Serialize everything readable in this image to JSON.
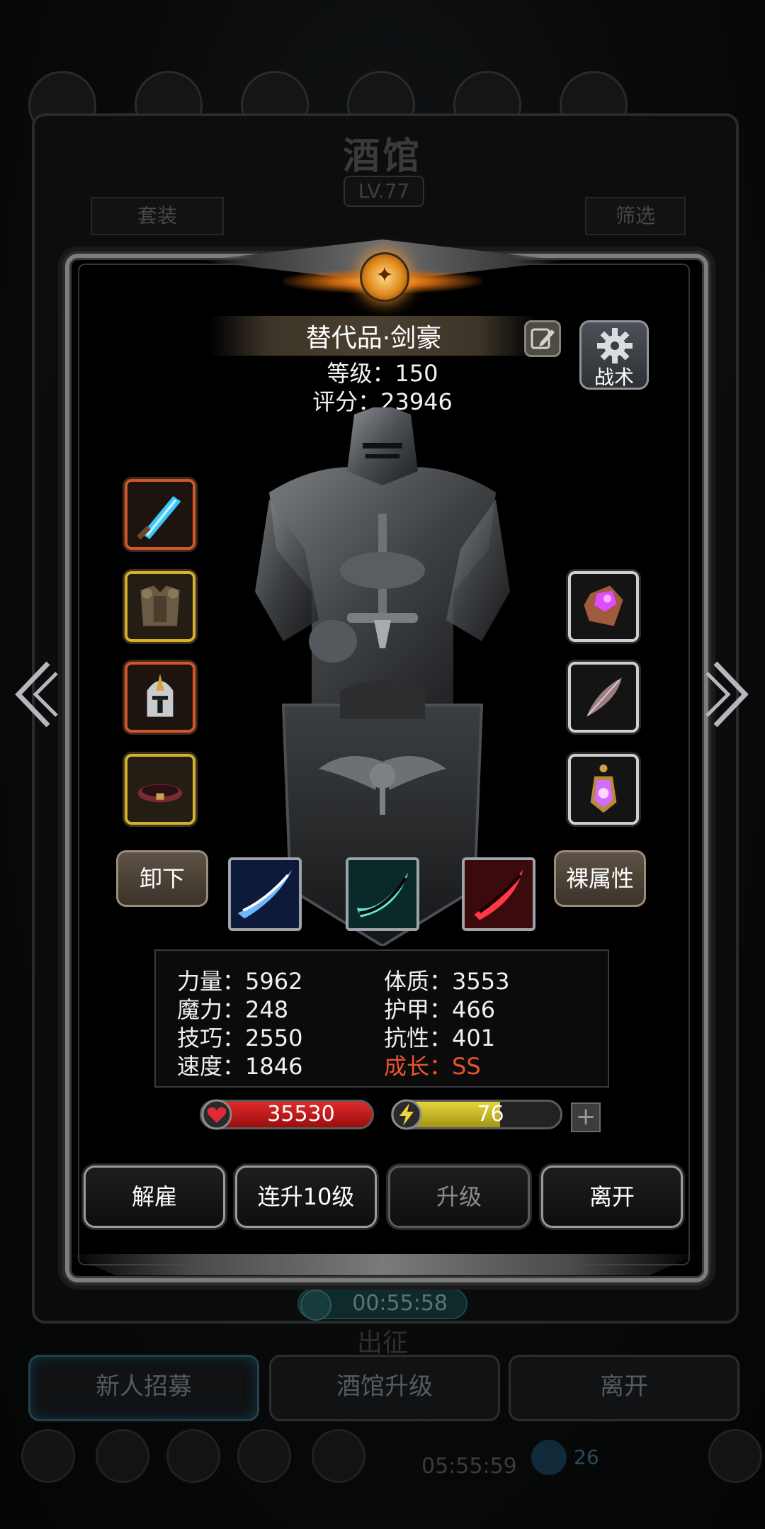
{
  "background": {
    "title": "酒馆",
    "level": "LV.77",
    "tab_left": "套装",
    "tab_right": "筛选",
    "timer": "00:55:58",
    "march_label": "出征",
    "buttons": [
      "新人招募",
      "酒馆升级",
      "离开"
    ],
    "bottom_time": "05:55:59",
    "bottom_count": "26"
  },
  "hero": {
    "name": "替代品·剑豪",
    "level_text": "等级：150",
    "score_text": "评分：23946",
    "tactics_label": "战术"
  },
  "equipment": {
    "left": [
      "weapon-crystal-sword",
      "armor-chest",
      "helmet",
      "belt"
    ],
    "right": [
      "gem-purple",
      "feather-charm",
      "lantern-amulet"
    ]
  },
  "actions": {
    "unequip": "卸下",
    "base_attributes": "裸属性"
  },
  "skills": [
    "skill-blue-slash",
    "skill-cyan-slash",
    "skill-red-slash"
  ],
  "stats": {
    "strength": "力量：5962",
    "constitution": "体质：3553",
    "magic": "魔力：248",
    "armor": "护甲：466",
    "skill": "技巧：2550",
    "resistance": "抗性：401",
    "speed": "速度：1846",
    "growth": "成长：SS"
  },
  "bars": {
    "hp": "35530",
    "energy": "76",
    "energy_fill": 0.64,
    "plus": "+"
  },
  "dialog_buttons": {
    "dismiss": "解雇",
    "level_up_10": "连升10级",
    "level_up": "升级",
    "leave": "离开"
  },
  "colors": {
    "growth": "#e7542c",
    "hp": "#d01c1c",
    "energy": "#d2c228"
  }
}
